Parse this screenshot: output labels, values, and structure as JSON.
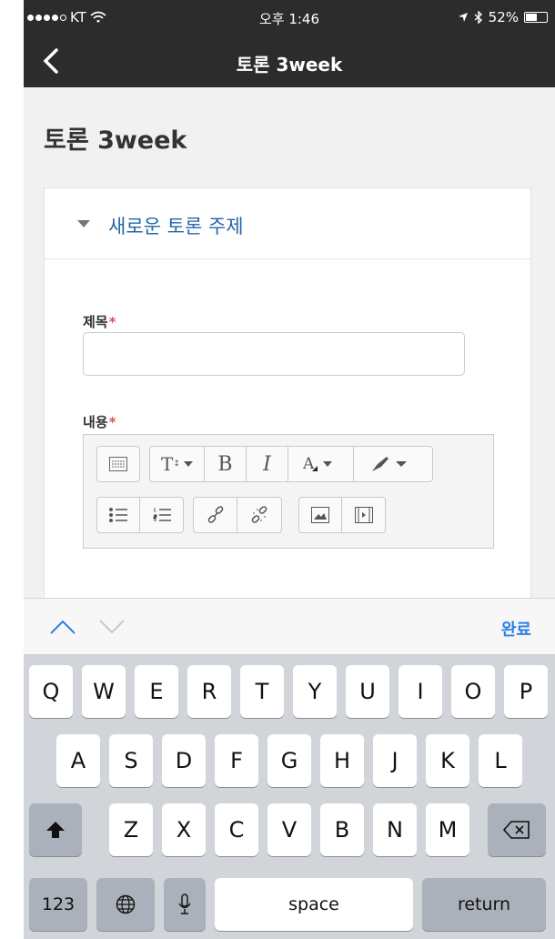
{
  "status_bar": {
    "carrier": "KT",
    "time": "오후 1:46",
    "battery": "52%"
  },
  "nav": {
    "title": "토론 3week"
  },
  "page": {
    "title": "토론 3week"
  },
  "section": {
    "header": "새로운 토론 주제"
  },
  "form": {
    "subject_label": "제목",
    "content_label": "내용",
    "required_mark": "*",
    "subject_value": ""
  },
  "toolbar": {
    "row1": [
      "show-more-icon",
      "text-style-icon",
      "bold-icon",
      "italic-icon",
      "font-color-icon",
      "highlight-icon"
    ],
    "row2": [
      "unordered-list-icon",
      "ordered-list-icon",
      "link-icon",
      "unlink-icon",
      "image-icon",
      "media-icon"
    ],
    "bold_glyph": "B",
    "italic_glyph": "I"
  },
  "accessory": {
    "done_label": "완료"
  },
  "keyboard": {
    "row1": [
      "Q",
      "W",
      "E",
      "R",
      "T",
      "Y",
      "U",
      "I",
      "O",
      "P"
    ],
    "row2": [
      "A",
      "S",
      "D",
      "F",
      "G",
      "H",
      "J",
      "K",
      "L"
    ],
    "row3": [
      "Z",
      "X",
      "C",
      "V",
      "B",
      "N",
      "M"
    ],
    "numbers_label": "123",
    "space_label": "space",
    "return_label": "return"
  },
  "colors": {
    "accent": "#2a7fe8",
    "link": "#2466a8",
    "required": "#d9534f",
    "bar": "#2c2c2c"
  }
}
